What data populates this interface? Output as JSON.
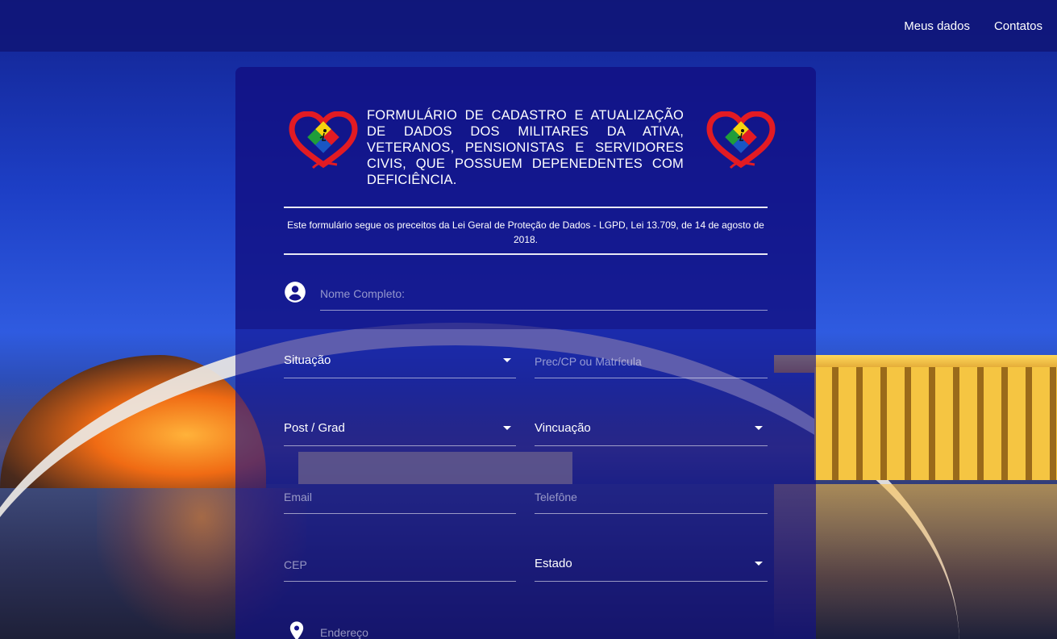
{
  "nav": {
    "links": [
      "Meus dados",
      "Contatos"
    ]
  },
  "form": {
    "title": "FORMULÁRIO DE CADASTRO E ATUALIZAÇÃO DE DADOS DOS MILITARES DA ATIVA, VETERANOS, PENSIONISTAS E SERVIDORES CIVIS, QUE POSSUEM DEPENEDENTES COM DEFICIÊNCIA.",
    "lgpd_notice": "Este formulário segue os preceitos da Lei Geral de Proteção de Dados - LGPD, Lei 13.709, de 14 de agosto de 2018.",
    "fields": {
      "nome_completo": {
        "placeholder": "Nome Completo:",
        "icon": "account-circle-icon"
      },
      "situacao": {
        "label": "Situação",
        "type": "select"
      },
      "prec_cp": {
        "placeholder": "Prec/CP ou Matrícula"
      },
      "post_grad": {
        "label": "Post / Grad",
        "type": "select"
      },
      "vinculacao": {
        "label": "Vincuação",
        "type": "select"
      },
      "email": {
        "placeholder": "Email"
      },
      "telefone": {
        "placeholder": "Telefône"
      },
      "cep": {
        "placeholder": "CEP"
      },
      "estado": {
        "label": "Estado",
        "type": "select"
      },
      "endereco": {
        "placeholder": "Endereço",
        "icon": "location-pin-icon"
      }
    }
  },
  "colors": {
    "navbar": "#101678",
    "card": "#100e8c",
    "text": "#ffffff",
    "placeholder": "#e1e1f0",
    "logo_heart": "#e21b23"
  },
  "logos": {
    "left_icon": "heart-accessibility-logo-icon",
    "right_icon": "heart-accessibility-logo-icon"
  }
}
